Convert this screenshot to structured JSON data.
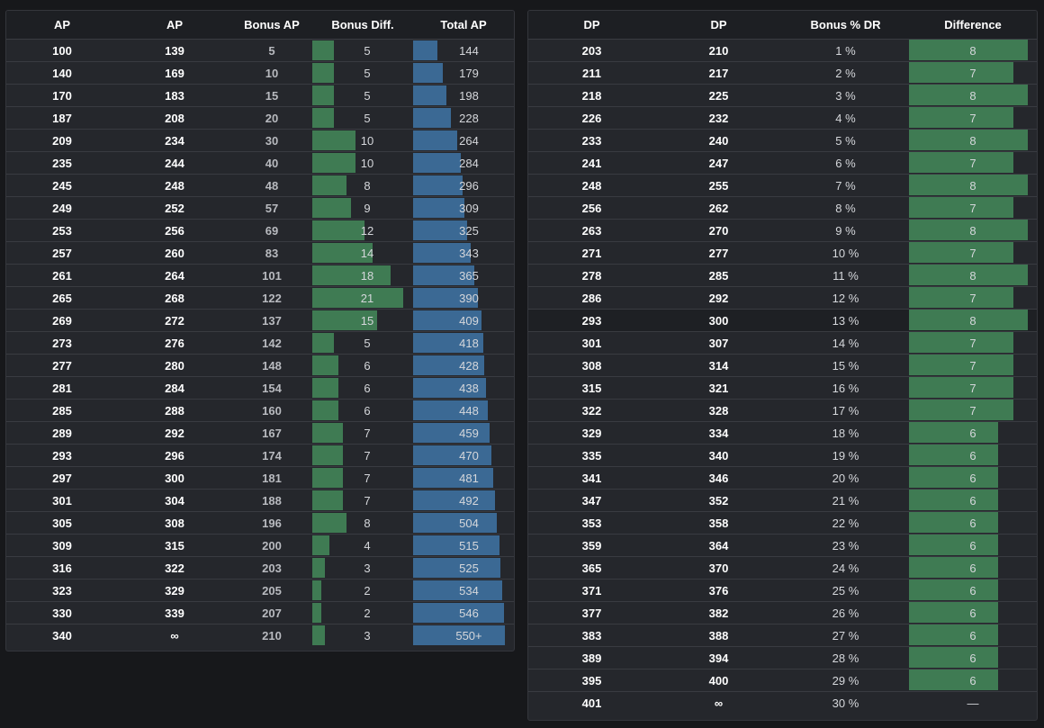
{
  "ap_table": {
    "headers": [
      "AP",
      "AP",
      "Bonus AP",
      "Bonus Diff.",
      "Total AP"
    ],
    "max_bonus_diff": 21,
    "max_total_ap": 550,
    "rows": [
      {
        "ap_from": "100",
        "ap_to": "139",
        "bonus_ap": "5",
        "bonus_diff": "5",
        "total_ap": "144"
      },
      {
        "ap_from": "140",
        "ap_to": "169",
        "bonus_ap": "10",
        "bonus_diff": "5",
        "total_ap": "179"
      },
      {
        "ap_from": "170",
        "ap_to": "183",
        "bonus_ap": "15",
        "bonus_diff": "5",
        "total_ap": "198"
      },
      {
        "ap_from": "187",
        "ap_to": "208",
        "bonus_ap": "20",
        "bonus_diff": "5",
        "total_ap": "228"
      },
      {
        "ap_from": "209",
        "ap_to": "234",
        "bonus_ap": "30",
        "bonus_diff": "10",
        "total_ap": "264"
      },
      {
        "ap_from": "235",
        "ap_to": "244",
        "bonus_ap": "40",
        "bonus_diff": "10",
        "total_ap": "284"
      },
      {
        "ap_from": "245",
        "ap_to": "248",
        "bonus_ap": "48",
        "bonus_diff": "8",
        "total_ap": "296"
      },
      {
        "ap_from": "249",
        "ap_to": "252",
        "bonus_ap": "57",
        "bonus_diff": "9",
        "total_ap": "309"
      },
      {
        "ap_from": "253",
        "ap_to": "256",
        "bonus_ap": "69",
        "bonus_diff": "12",
        "total_ap": "325"
      },
      {
        "ap_from": "257",
        "ap_to": "260",
        "bonus_ap": "83",
        "bonus_diff": "14",
        "total_ap": "343"
      },
      {
        "ap_from": "261",
        "ap_to": "264",
        "bonus_ap": "101",
        "bonus_diff": "18",
        "total_ap": "365"
      },
      {
        "ap_from": "265",
        "ap_to": "268",
        "bonus_ap": "122",
        "bonus_diff": "21",
        "total_ap": "390"
      },
      {
        "ap_from": "269",
        "ap_to": "272",
        "bonus_ap": "137",
        "bonus_diff": "15",
        "total_ap": "409"
      },
      {
        "ap_from": "273",
        "ap_to": "276",
        "bonus_ap": "142",
        "bonus_diff": "5",
        "total_ap": "418"
      },
      {
        "ap_from": "277",
        "ap_to": "280",
        "bonus_ap": "148",
        "bonus_diff": "6",
        "total_ap": "428"
      },
      {
        "ap_from": "281",
        "ap_to": "284",
        "bonus_ap": "154",
        "bonus_diff": "6",
        "total_ap": "438"
      },
      {
        "ap_from": "285",
        "ap_to": "288",
        "bonus_ap": "160",
        "bonus_diff": "6",
        "total_ap": "448"
      },
      {
        "ap_from": "289",
        "ap_to": "292",
        "bonus_ap": "167",
        "bonus_diff": "7",
        "total_ap": "459"
      },
      {
        "ap_from": "293",
        "ap_to": "296",
        "bonus_ap": "174",
        "bonus_diff": "7",
        "total_ap": "470"
      },
      {
        "ap_from": "297",
        "ap_to": "300",
        "bonus_ap": "181",
        "bonus_diff": "7",
        "total_ap": "481"
      },
      {
        "ap_from": "301",
        "ap_to": "304",
        "bonus_ap": "188",
        "bonus_diff": "7",
        "total_ap": "492"
      },
      {
        "ap_from": "305",
        "ap_to": "308",
        "bonus_ap": "196",
        "bonus_diff": "8",
        "total_ap": "504"
      },
      {
        "ap_from": "309",
        "ap_to": "315",
        "bonus_ap": "200",
        "bonus_diff": "4",
        "total_ap": "515"
      },
      {
        "ap_from": "316",
        "ap_to": "322",
        "bonus_ap": "203",
        "bonus_diff": "3",
        "total_ap": "525"
      },
      {
        "ap_from": "323",
        "ap_to": "329",
        "bonus_ap": "205",
        "bonus_diff": "2",
        "total_ap": "534"
      },
      {
        "ap_from": "330",
        "ap_to": "339",
        "bonus_ap": "207",
        "bonus_diff": "2",
        "total_ap": "546"
      },
      {
        "ap_from": "340",
        "ap_to": "∞",
        "bonus_ap": "210",
        "bonus_diff": "3",
        "total_ap": "550+"
      }
    ]
  },
  "dp_table": {
    "headers": [
      "DP",
      "DP",
      "Bonus % DR",
      "Difference"
    ],
    "max_difference": 8,
    "rows": [
      {
        "dp_from": "203",
        "dp_to": "210",
        "bonus_dr": "1 %",
        "difference": "8"
      },
      {
        "dp_from": "211",
        "dp_to": "217",
        "bonus_dr": "2 %",
        "difference": "7"
      },
      {
        "dp_from": "218",
        "dp_to": "225",
        "bonus_dr": "3 %",
        "difference": "8"
      },
      {
        "dp_from": "226",
        "dp_to": "232",
        "bonus_dr": "4 %",
        "difference": "7"
      },
      {
        "dp_from": "233",
        "dp_to": "240",
        "bonus_dr": "5 %",
        "difference": "8"
      },
      {
        "dp_from": "241",
        "dp_to": "247",
        "bonus_dr": "6 %",
        "difference": "7"
      },
      {
        "dp_from": "248",
        "dp_to": "255",
        "bonus_dr": "7 %",
        "difference": "8"
      },
      {
        "dp_from": "256",
        "dp_to": "262",
        "bonus_dr": "8 %",
        "difference": "7"
      },
      {
        "dp_from": "263",
        "dp_to": "270",
        "bonus_dr": "9 %",
        "difference": "8"
      },
      {
        "dp_from": "271",
        "dp_to": "277",
        "bonus_dr": "10 %",
        "difference": "7"
      },
      {
        "dp_from": "278",
        "dp_to": "285",
        "bonus_dr": "11 %",
        "difference": "8"
      },
      {
        "dp_from": "286",
        "dp_to": "292",
        "bonus_dr": "12 %",
        "difference": "7"
      },
      {
        "dp_from": "293",
        "dp_to": "300",
        "bonus_dr": "13 %",
        "difference": "8"
      },
      {
        "dp_from": "301",
        "dp_to": "307",
        "bonus_dr": "14 %",
        "difference": "7"
      },
      {
        "dp_from": "308",
        "dp_to": "314",
        "bonus_dr": "15 %",
        "difference": "7"
      },
      {
        "dp_from": "315",
        "dp_to": "321",
        "bonus_dr": "16 %",
        "difference": "7"
      },
      {
        "dp_from": "322",
        "dp_to": "328",
        "bonus_dr": "17 %",
        "difference": "7"
      },
      {
        "dp_from": "329",
        "dp_to": "334",
        "bonus_dr": "18 %",
        "difference": "6"
      },
      {
        "dp_from": "335",
        "dp_to": "340",
        "bonus_dr": "19 %",
        "difference": "6"
      },
      {
        "dp_from": "341",
        "dp_to": "346",
        "bonus_dr": "20 %",
        "difference": "6"
      },
      {
        "dp_from": "347",
        "dp_to": "352",
        "bonus_dr": "21 %",
        "difference": "6"
      },
      {
        "dp_from": "353",
        "dp_to": "358",
        "bonus_dr": "22 %",
        "difference": "6"
      },
      {
        "dp_from": "359",
        "dp_to": "364",
        "bonus_dr": "23 %",
        "difference": "6"
      },
      {
        "dp_from": "365",
        "dp_to": "370",
        "bonus_dr": "24 %",
        "difference": "6"
      },
      {
        "dp_from": "371",
        "dp_to": "376",
        "bonus_dr": "25 %",
        "difference": "6"
      },
      {
        "dp_from": "377",
        "dp_to": "382",
        "bonus_dr": "26 %",
        "difference": "6"
      },
      {
        "dp_from": "383",
        "dp_to": "388",
        "bonus_dr": "27 %",
        "difference": "6"
      },
      {
        "dp_from": "389",
        "dp_to": "394",
        "bonus_dr": "28 %",
        "difference": "6"
      },
      {
        "dp_from": "395",
        "dp_to": "400",
        "bonus_dr": "29 %",
        "difference": "6"
      },
      {
        "dp_from": "401",
        "dp_to": "∞",
        "bonus_dr": "30 %",
        "difference": "—"
      }
    ]
  },
  "colors": {
    "bonus_bar": "#3f7b53",
    "total_bar": "#3b6994",
    "difference_bar": "#3f7b53"
  }
}
